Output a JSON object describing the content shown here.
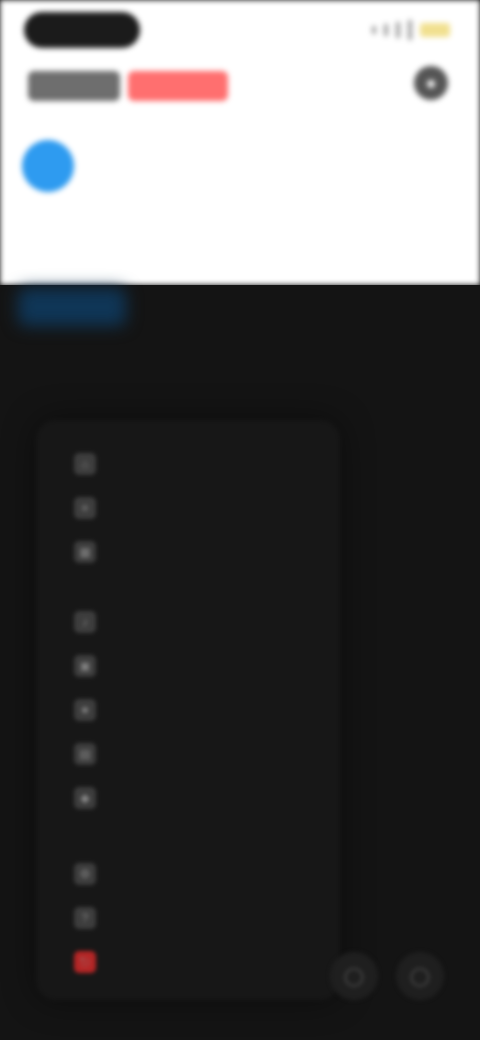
{
  "status": {
    "time": "",
    "signal_bars": 4
  },
  "header": {
    "brand_left": "",
    "brand_right": ""
  },
  "menu": {
    "groups": [
      {
        "items": [
          {
            "label": "",
            "icon": "home-icon"
          },
          {
            "label": "",
            "icon": "list-icon"
          },
          {
            "label": "",
            "icon": "grid-icon"
          }
        ]
      },
      {
        "items": [
          {
            "label": "",
            "icon": "bell-icon"
          },
          {
            "label": "",
            "icon": "folder-icon"
          },
          {
            "label": "",
            "icon": "star-icon"
          },
          {
            "label": "",
            "icon": "calendar-icon"
          },
          {
            "label": "",
            "icon": "tag-icon"
          }
        ]
      },
      {
        "items": [
          {
            "label": "",
            "icon": "settings-icon"
          },
          {
            "label": "",
            "icon": "help-icon"
          },
          {
            "label": "",
            "icon": "logout-icon",
            "accent": "#b52525"
          }
        ]
      }
    ]
  },
  "colors": {
    "accent_blue": "#2e9bf0",
    "accent_red": "#ff6f6f",
    "danger": "#b52525",
    "background_dark": "#141414",
    "background_light": "#ffffff"
  }
}
